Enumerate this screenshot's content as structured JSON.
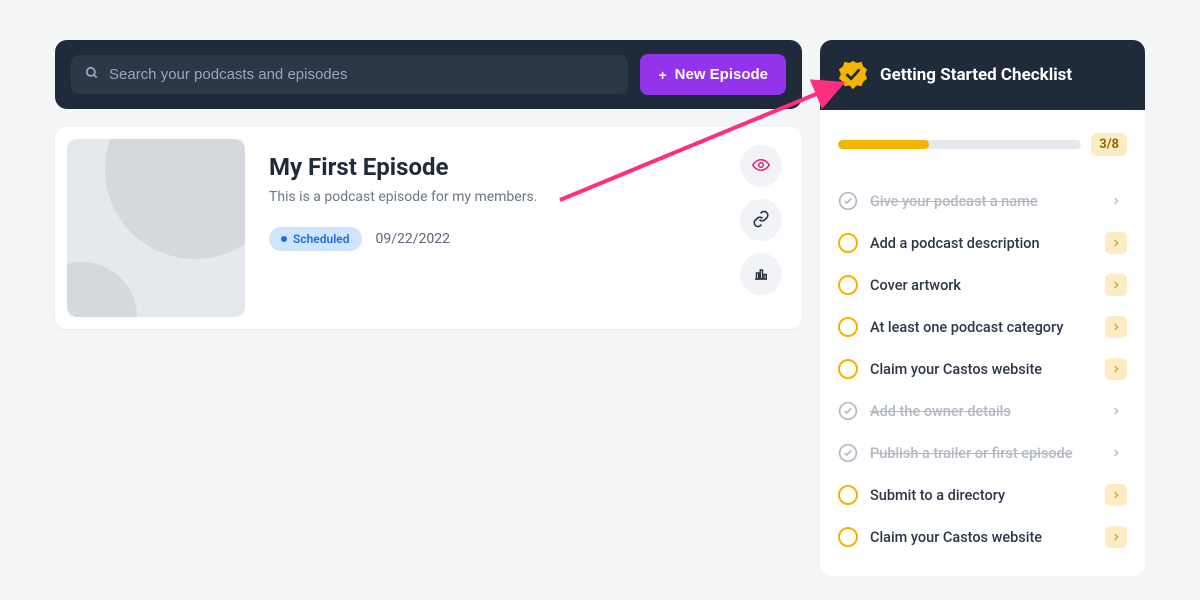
{
  "topbar": {
    "search_placeholder": "Search your podcasts and episodes",
    "new_button_label": "New Episode"
  },
  "episode": {
    "title": "My First Episode",
    "description": "This is a podcast episode for my members.",
    "status_label": "Scheduled",
    "date": "09/22/2022"
  },
  "checklist": {
    "title": "Getting Started Checklist",
    "progress_text": "3/8",
    "items": [
      {
        "label": "Give your podcast a name",
        "done": true
      },
      {
        "label": "Add a podcast description",
        "done": false
      },
      {
        "label": "Cover artwork",
        "done": false
      },
      {
        "label": "At least one podcast category",
        "done": false
      },
      {
        "label": "Claim your Castos website",
        "done": false
      },
      {
        "label": "Add the owner details",
        "done": true
      },
      {
        "label": "Publish a trailer or first episode",
        "done": true
      },
      {
        "label": "Submit to a directory",
        "done": false
      },
      {
        "label": "Claim your Castos website",
        "done": false
      }
    ]
  }
}
